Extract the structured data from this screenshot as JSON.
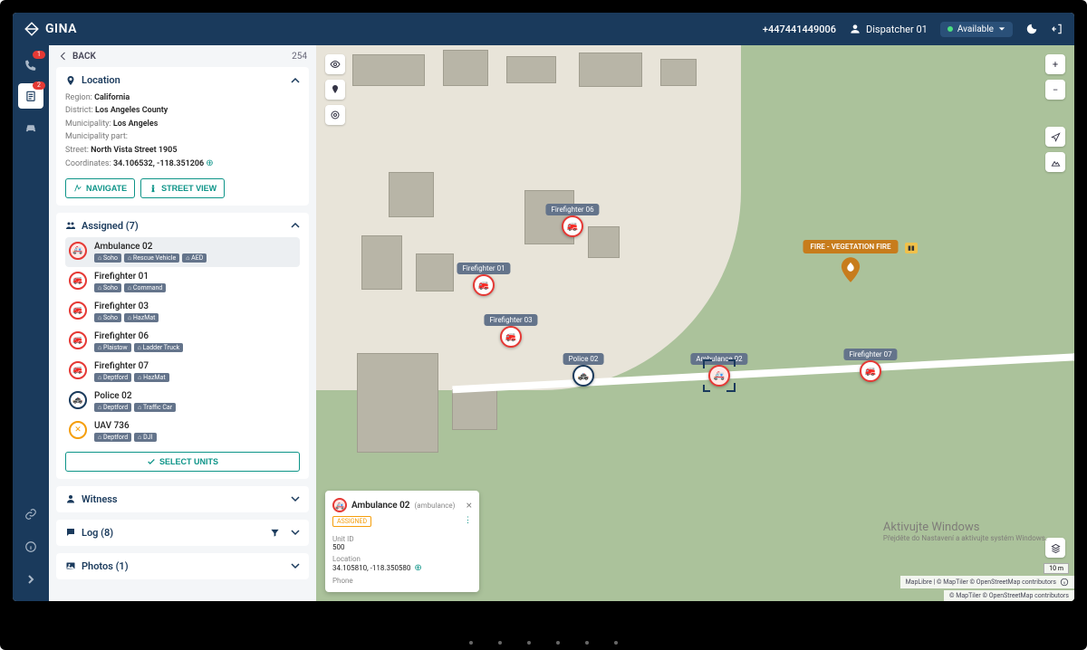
{
  "app": {
    "name": "GINA"
  },
  "topbar": {
    "phone": "+447441449006",
    "user": "Dispatcher 01",
    "status": "Available"
  },
  "nav_rail": {
    "phone_badge": "1",
    "board_badge": "2"
  },
  "side": {
    "back_label": "BACK",
    "count": "254"
  },
  "location": {
    "title": "Location",
    "region_lbl": "Region:",
    "region": "California",
    "district_lbl": "District:",
    "district": "Los Angeles County",
    "municipality_lbl": "Municipality:",
    "municipality": "Los Angeles",
    "muni_part_lbl": "Municipality part:",
    "street_lbl": "Street:",
    "street": "North Vista Street 1905",
    "coords_lbl": "Coordinates:",
    "coords": "34.106532, -118.351206",
    "navigate_btn": "NAVIGATE",
    "streetview_btn": "STREET VIEW"
  },
  "assigned": {
    "title": "Assigned (7)",
    "select_units_btn": "SELECT UNITS",
    "units": [
      {
        "name": "Ambulance 02",
        "type": "ambulance",
        "tags": [
          "Soho",
          "Rescue Vehicle",
          "AED"
        ],
        "selected": true
      },
      {
        "name": "Firefighter 01",
        "type": "fire",
        "tags": [
          "Soho",
          "Command"
        ]
      },
      {
        "name": "Firefighter 03",
        "type": "fire",
        "tags": [
          "Soho",
          "HazMat"
        ]
      },
      {
        "name": "Firefighter 06",
        "type": "fire",
        "tags": [
          "Plaistow",
          "Ladder Truck"
        ]
      },
      {
        "name": "Firefighter 07",
        "type": "fire",
        "tags": [
          "Deptford",
          "HazMat"
        ]
      },
      {
        "name": "Police 02",
        "type": "police",
        "tags": [
          "Deptford",
          "Traffic Car"
        ]
      },
      {
        "name": "UAV 736",
        "type": "uav",
        "tags": [
          "Deptford",
          "DJI"
        ]
      }
    ]
  },
  "sections": {
    "witness": "Witness",
    "log": "Log (8)",
    "photos": "Photos (1)"
  },
  "incident": {
    "label": "FIRE - VEGETATION FIRE"
  },
  "map_markers": {
    "ff01": "Firefighter 01",
    "ff03": "Firefighter 03",
    "ff06": "Firefighter 06",
    "ff07": "Firefighter 07",
    "pol02": "Police 02",
    "amb02": "Ambulance 02"
  },
  "popup": {
    "title": "Ambulance 02",
    "subtitle": "(ambulance)",
    "status": "ASSIGNED",
    "unit_id_lbl": "Unit ID",
    "unit_id": "500",
    "location_lbl": "Location",
    "location": "34.105810, -118.350580",
    "phone_lbl": "Phone"
  },
  "map": {
    "scale": "10 m",
    "attribution1": "MapLibre | © MapTiler © OpenStreetMap contributors",
    "attribution2": "© MapTiler © OpenStreetMap contributors"
  },
  "watermark": {
    "line1": "Aktivujte Windows",
    "line2": "Přejděte do Nastavení a aktivujte systém Windows."
  }
}
